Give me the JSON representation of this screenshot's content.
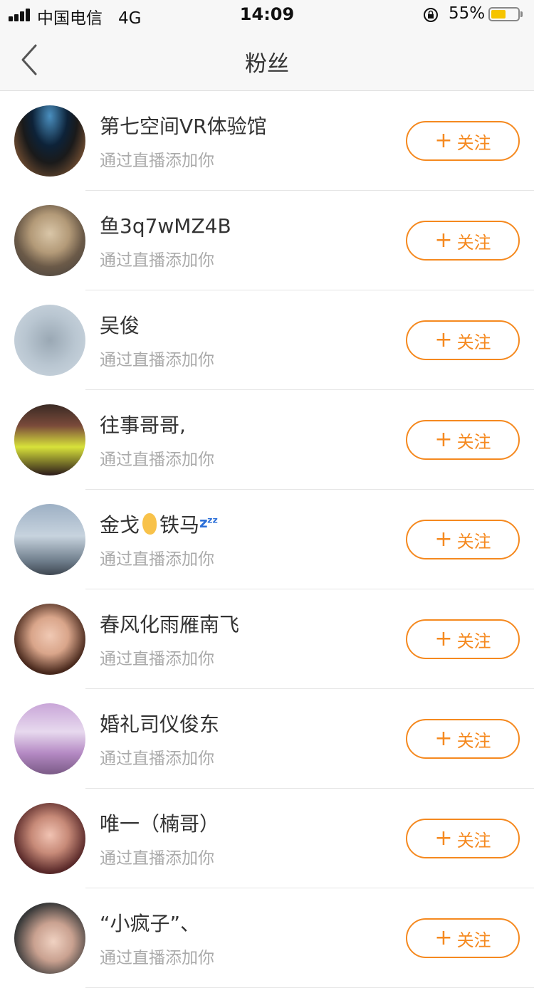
{
  "status_bar": {
    "carrier": "中国电信",
    "network": "4G",
    "time": "14:09",
    "battery_percent": "55%",
    "battery_level": 0.55,
    "battery_color": "#f6c400"
  },
  "nav": {
    "back_icon": "chevron-left-icon",
    "title": "粉丝"
  },
  "accent_color": "#f5891f",
  "fans": [
    {
      "name": "第七空间VR体验馆",
      "subtitle": "通过直播添加你",
      "button": "关注"
    },
    {
      "name": "鱼3q7wMZ4B",
      "subtitle": "通过直播添加你",
      "button": "关注"
    },
    {
      "name": "吴俊",
      "subtitle": "通过直播添加你",
      "button": "关注"
    },
    {
      "name": "往事哥哥,",
      "subtitle": "通过直播添加你",
      "button": "关注"
    },
    {
      "name": "金戈",
      "name_suffix": "铁马",
      "subtitle": "通过直播添加你",
      "button": "关注"
    },
    {
      "name": "春风化雨雁南飞",
      "subtitle": "通过直播添加你",
      "button": "关注"
    },
    {
      "name": "婚礼司仪俊东",
      "subtitle": "通过直播添加你",
      "button": "关注"
    },
    {
      "name": "唯一（楠哥）",
      "subtitle": "通过直播添加你",
      "button": "关注"
    },
    {
      "name": "“小疯子”、",
      "subtitle": "通过直播添加你",
      "button": "关注"
    }
  ]
}
